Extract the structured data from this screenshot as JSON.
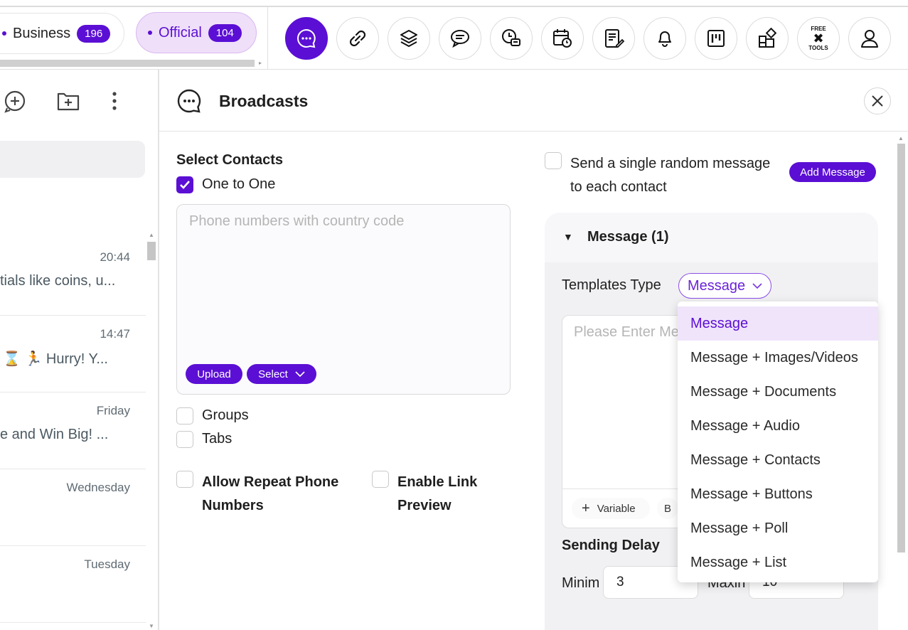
{
  "top_tabs": [
    {
      "label": "Business",
      "count": "196"
    },
    {
      "label": "Official",
      "count": "104"
    }
  ],
  "toolbar_icons": [
    "chat-bubble-icon",
    "link-icon",
    "layers-icon",
    "speech-icon",
    "schedule-chat-icon",
    "calendar-clock-icon",
    "notes-edit-icon",
    "bell-icon",
    "kanban-icon",
    "widgets-icon",
    "free-tools-icon",
    "user-icon"
  ],
  "free_tools": {
    "line1": "FREE",
    "line2": "TOOLS"
  },
  "chat_list": [
    {
      "time": "20:44",
      "preview": "tials like coins, u..."
    },
    {
      "time": "14:47",
      "preview": "⌛ 🏃 Hurry! Y..."
    },
    {
      "time": "Friday",
      "preview": "e and Win Big! ..."
    },
    {
      "time": "Wednesday",
      "preview": ""
    },
    {
      "time": "Tuesday",
      "preview": ""
    }
  ],
  "broadcasts": {
    "title": "Broadcasts",
    "select_contacts": "Select Contacts",
    "one_to_one": "One to One",
    "phone_placeholder": "Phone numbers with country code",
    "upload": "Upload",
    "select": "Select",
    "groups": "Groups",
    "tabs": "Tabs",
    "allow_repeat_line1": "Allow Repeat Phone",
    "allow_repeat_line2": "Numbers",
    "enable_link_line1": "Enable Link",
    "enable_link_line2": "Preview",
    "random_line1": "Send a single random message",
    "random_line2": "to each contact",
    "add_message": "Add Message",
    "message_header": "Message (1)",
    "templates_type": "Templates Type",
    "templates_value": "Message",
    "editor_placeholder": "Please Enter Me",
    "variable": "Variable",
    "bold": "B",
    "sending_delay": "Sending Delay",
    "min_label": "Minim",
    "min_value": "3",
    "max_label": "Maxin",
    "max_value": "10"
  },
  "template_options": [
    "Message",
    "Message + Images/Videos",
    "Message + Documents",
    "Message + Audio",
    "Message + Contacts",
    "Message + Buttons",
    "Message + Poll",
    "Message + List"
  ],
  "colors": {
    "accent": "#5b0fd4",
    "accent_light": "#efdff9"
  }
}
